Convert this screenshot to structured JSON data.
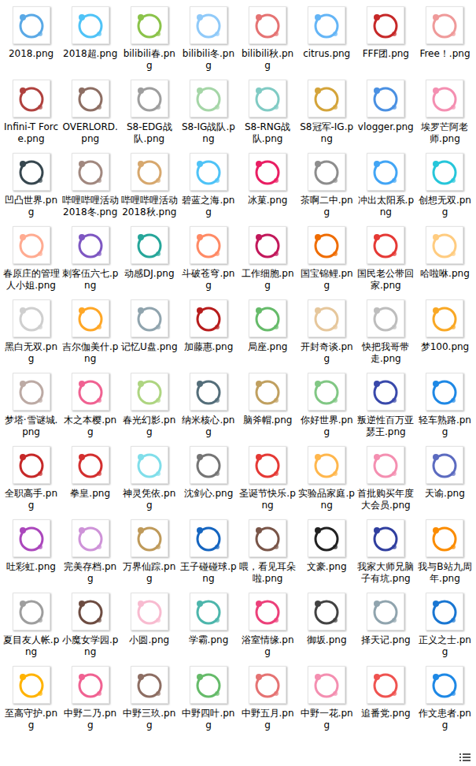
{
  "folder": {
    "files": [
      {
        "name": "2018.png",
        "color": "#5aa9e6"
      },
      {
        "name": "2018超.png",
        "color": "#4fc3f7"
      },
      {
        "name": "bilibili春.png",
        "color": "#8bc34a"
      },
      {
        "name": "bilibili冬.png",
        "color": "#90caf9"
      },
      {
        "name": "bilibili秋.png",
        "color": "#e57373"
      },
      {
        "name": "citrus.png",
        "color": "#64b5f6"
      },
      {
        "name": "FFF团.png",
        "color": "#c62828"
      },
      {
        "name": "Free！.png",
        "color": "#ef9a9a"
      },
      {
        "name": "Infini-T Force.png",
        "color": "#b0413e"
      },
      {
        "name": "OVERLORD.png",
        "color": "#8d6e63"
      },
      {
        "name": "S8-EDG战队.png",
        "color": "#9e9e9e"
      },
      {
        "name": "S8-IG战队.png",
        "color": "#a5d6a7"
      },
      {
        "name": "S8-RNG战队.png",
        "color": "#80cbc4"
      },
      {
        "name": "S8冠军-IG.png",
        "color": "#d4a43a"
      },
      {
        "name": "vlogger.png",
        "color": "#4a90e2"
      },
      {
        "name": "埃罗芒阿老师.png",
        "color": "#f48fb1"
      },
      {
        "name": "凹凸世界.png",
        "color": "#37474f"
      },
      {
        "name": "哔哩哔哩活动 2018冬.png",
        "color": "#a1887f"
      },
      {
        "name": "哔哩哔哩活动 2018秋.png",
        "color": "#d7a86e"
      },
      {
        "name": "碧蓝之海.png",
        "color": "#4fc3f7"
      },
      {
        "name": "冰菓.png",
        "color": "#e91e63"
      },
      {
        "name": "茶啊二中.png",
        "color": "#8d8d8d"
      },
      {
        "name": "冲出太阳系.png",
        "color": "#42a5f5"
      },
      {
        "name": "创想无双.png",
        "color": "#26c6da"
      },
      {
        "name": "春原庄的管理人小姐.png",
        "color": "#ffab91"
      },
      {
        "name": "刺客伍六七.png",
        "color": "#7e57c2"
      },
      {
        "name": "动感DJ.png",
        "color": "#26a69a"
      },
      {
        "name": "斗破苍穹.png",
        "color": "#ff8a65"
      },
      {
        "name": "工作细胞.png",
        "color": "#c2185b"
      },
      {
        "name": "国宝锦鲤.png",
        "color": "#ef6c00"
      },
      {
        "name": "国民老公带回家.png",
        "color": "#e53935"
      },
      {
        "name": "哈啦咻.png",
        "color": "#ffcc80"
      },
      {
        "name": "黑白无双.png",
        "color": "#cfcfcf"
      },
      {
        "name": "吉尔伽美什.png",
        "color": "#ffa726"
      },
      {
        "name": "记忆U盘.png",
        "color": "#90a4ae"
      },
      {
        "name": "加藤惠.png",
        "color": "#b71c1c"
      },
      {
        "name": "局座.png",
        "color": "#66bb6a"
      },
      {
        "name": "开封奇谈.png",
        "color": "#e6c79c"
      },
      {
        "name": "快把我哥带走.png",
        "color": "#bdbdbd"
      },
      {
        "name": "梦100.png",
        "color": "#f9a825"
      },
      {
        "name": "梦塔·雪谜城.png",
        "color": "#bcaaa4"
      },
      {
        "name": "木之本樱.png",
        "color": "#f06292"
      },
      {
        "name": "春光幻影.png",
        "color": "#aed581"
      },
      {
        "name": "纳米核心.png",
        "color": "#546e7a"
      },
      {
        "name": "脑斧帽.png",
        "color": "#c0a060"
      },
      {
        "name": "你好世界.png",
        "color": "#81c784"
      },
      {
        "name": "叛逆性百万亚瑟王.png",
        "color": "#3949ab"
      },
      {
        "name": "轻车熟路.png",
        "color": "#1e88e5"
      },
      {
        "name": "全职高手.png",
        "color": "#c62828"
      },
      {
        "name": "拳皇.png",
        "color": "#d32f2f"
      },
      {
        "name": "神灵凭依.png",
        "color": "#80deea"
      },
      {
        "name": "沈剑心.png",
        "color": "#757575"
      },
      {
        "name": "圣诞节快乐.png",
        "color": "#e53935"
      },
      {
        "name": "实验品家庭.png",
        "color": "#ffb74d"
      },
      {
        "name": "首批购买年度大会员.png",
        "color": "#f48fb1"
      },
      {
        "name": "天谕.png",
        "color": "#5c6bc0"
      },
      {
        "name": "吐彩虹.png",
        "color": "#ab47bc"
      },
      {
        "name": "完美存档.png",
        "color": "#ce93d8"
      },
      {
        "name": "万界仙踪.png",
        "color": "#bf9a5a"
      },
      {
        "name": "王子碰碰球.png",
        "color": "#1565c0"
      },
      {
        "name": "喂，看见耳朵啦.png",
        "color": "#795548"
      },
      {
        "name": "文豪.png",
        "color": "#212121"
      },
      {
        "name": "我家大师兄脑子有坑.png",
        "color": "#303f9f"
      },
      {
        "name": "我与B站九周年.png",
        "color": "#fb8c00"
      },
      {
        "name": "夏目友人帐.png",
        "color": "#9e9e9e"
      },
      {
        "name": "小魔女学园.png",
        "color": "#6d4c41"
      },
      {
        "name": "小圆.png",
        "color": "#f8bbd0"
      },
      {
        "name": "学霸.png",
        "color": "#4db6ac"
      },
      {
        "name": "浴室情缘.png",
        "color": "#ec407a"
      },
      {
        "name": "御坂.png",
        "color": "#424242"
      },
      {
        "name": "择天记.png",
        "color": "#90a4ae"
      },
      {
        "name": "正义之士.png",
        "color": "#1976d2"
      },
      {
        "name": "至高守护.png",
        "color": "#ffb300"
      },
      {
        "name": "中野二乃.png",
        "color": "#f06292"
      },
      {
        "name": "中野三玖.png",
        "color": "#8d6e63"
      },
      {
        "name": "中野四叶.png",
        "color": "#66bb6a"
      },
      {
        "name": "中野五月.png",
        "color": "#e57373"
      },
      {
        "name": "中野一花.png",
        "color": "#f48fb1"
      },
      {
        "name": "追番党.png",
        "color": "#ef5350"
      },
      {
        "name": "作文患者.png",
        "color": "#1e88e5"
      }
    ]
  }
}
